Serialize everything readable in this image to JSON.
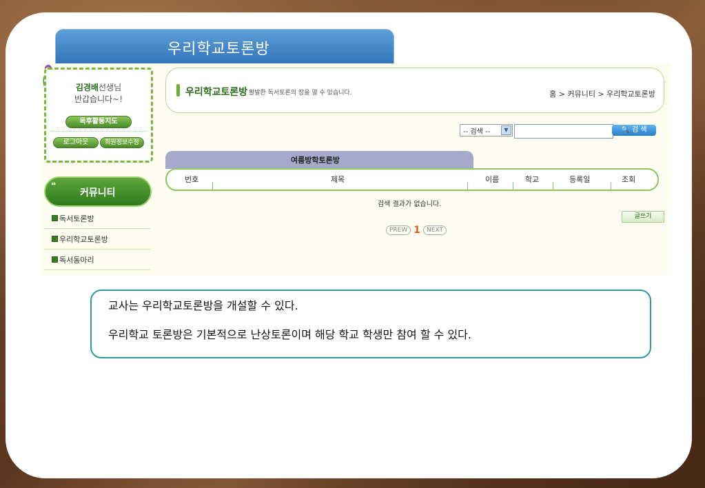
{
  "slide": {
    "title": "우리학교토론방"
  },
  "login": {
    "user_name": "김경배",
    "user_suffix": "선생님",
    "greeting": "반갑습니다~!",
    "reading_guide_button": "독후활동지도",
    "logout_button": "로그아웃",
    "edit_profile_button": "회원정보수정"
  },
  "sidebar": {
    "section_title": "커뮤니티",
    "items": [
      {
        "label": "독서토론방"
      },
      {
        "label": "우리학교토론방"
      },
      {
        "label": "독서동아리"
      }
    ]
  },
  "header": {
    "title": "우리학교토론방",
    "subtitle": "활발한 독서토론의 장을 열 수 있습니다.",
    "breadcrumb": "홈 > 커뮤니티 > 우리학교토론방"
  },
  "search": {
    "select_value": "-- 검색 --",
    "input_value": "",
    "button_label": "검 색"
  },
  "board": {
    "tab_label": "여름방학토론방",
    "columns": [
      "번호",
      "제목",
      "이름",
      "학교",
      "등록일",
      "조회"
    ],
    "empty_message": "검색 결과가 없습니다.",
    "write_button": "글쓰기"
  },
  "pager": {
    "prev": "PREW",
    "current": "1",
    "next": "NEXT"
  },
  "notes": [
    "교사는 우리학교토론방을 개설할 수 있다.",
    "우리학교 토론방은 기본적으로 난상토론이며 해당 학교 학생만 참여 할 수 있다."
  ],
  "colors": {
    "accent_green": "#6ab03a",
    "title_blue": "#2c6fb5",
    "note_border": "#2a9aa0"
  }
}
